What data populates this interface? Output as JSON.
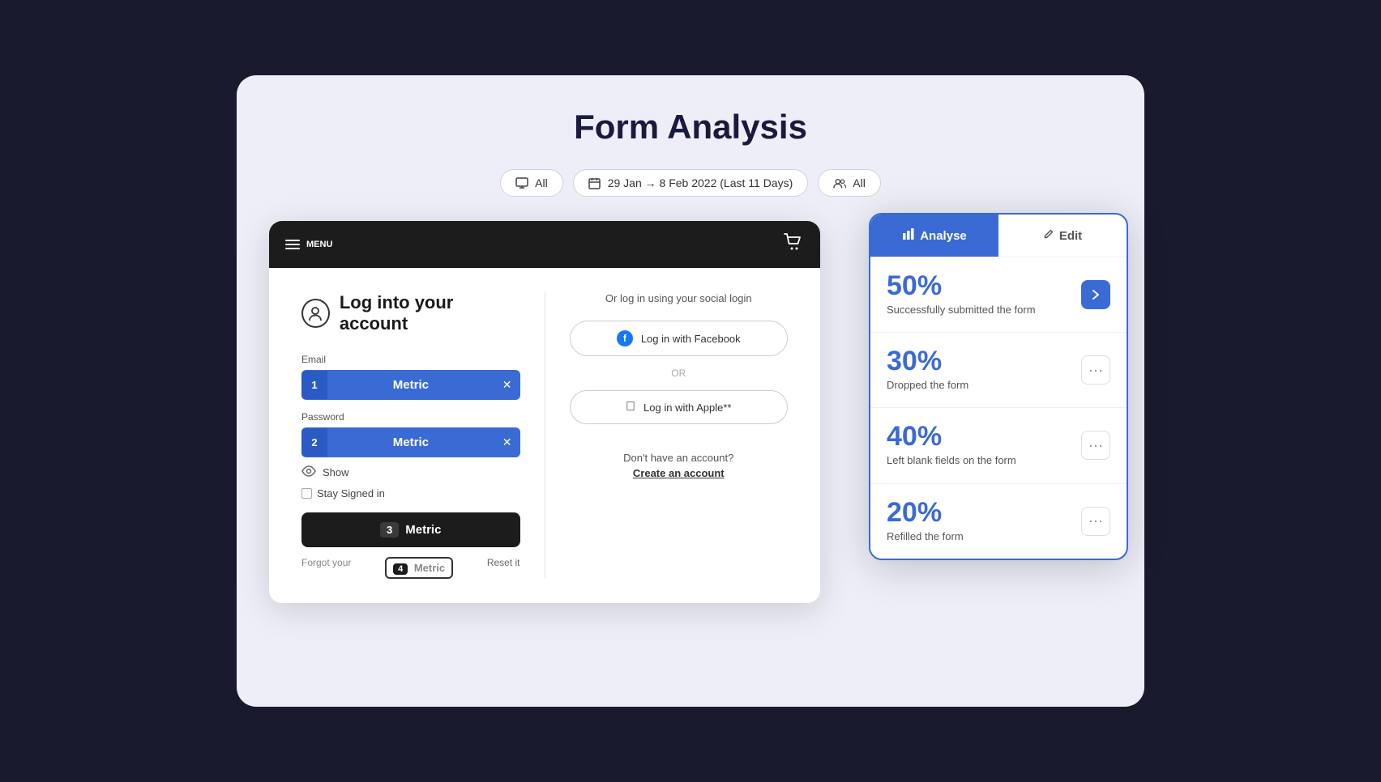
{
  "page": {
    "title": "Form Analysis",
    "background_color": "#eeeef8"
  },
  "filters": [
    {
      "id": "device",
      "label": "All",
      "icon": "monitor-icon"
    },
    {
      "id": "date",
      "label": "29 Jan → 8 Feb 2022 (Last 11 Days)",
      "icon": "calendar-icon"
    },
    {
      "id": "users",
      "label": "All",
      "icon": "users-icon"
    }
  ],
  "form_preview": {
    "browser_menu_label": "MENU",
    "form_title": "Log into your account",
    "email_label": "Email",
    "email_badge": "1",
    "email_metric": "Metric",
    "password_label": "Password",
    "password_badge": "2",
    "password_metric": "Metric",
    "show_label": "Show",
    "stay_signed_label": "Stay Signed in",
    "login_badge": "3",
    "login_metric": "Metric",
    "forgot_text": "Forgot your",
    "forgot_metric": "Metric",
    "reset_label": "Reset it",
    "social_title": "Or log in using your social login",
    "facebook_btn": "Log in with Facebook",
    "apple_btn": "Log in with Apple**",
    "or_label": "OR",
    "no_account_text": "Don't have an account?",
    "create_account_link": "Create an account"
  },
  "analysis_panel": {
    "analyse_tab": "Analyse",
    "edit_tab": "Edit",
    "metrics": [
      {
        "percent": "50%",
        "description": "Successfully submitted the form",
        "action": "arrow"
      },
      {
        "percent": "30%",
        "description": "Dropped the form",
        "action": "dots"
      },
      {
        "percent": "40%",
        "description": "Left blank fields on the form",
        "action": "dots"
      },
      {
        "percent": "20%",
        "description": "Refilled the form",
        "action": "dots"
      }
    ]
  }
}
